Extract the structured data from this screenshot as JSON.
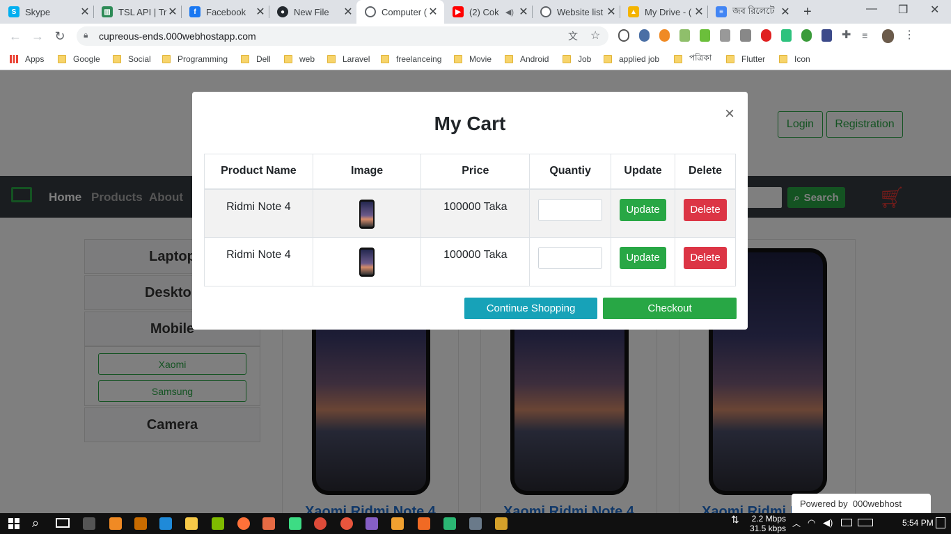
{
  "tabs": [
    {
      "title": "Skype",
      "icon": "skype-icon",
      "color": "#00aff0"
    },
    {
      "title": "TSL API | Tr",
      "icon": "trello-icon",
      "color": "#2e8b57"
    },
    {
      "title": "Facebook",
      "icon": "facebook-icon",
      "color": "#1877f2"
    },
    {
      "title": "New File",
      "icon": "github-icon",
      "color": "#24292e"
    },
    {
      "title": "Computer (",
      "icon": "globe-icon",
      "color": "#5f6368"
    },
    {
      "title": "(2) Cok",
      "icon": "youtube-icon",
      "color": "#ff0000"
    },
    {
      "title": "Website list",
      "icon": "globe-icon",
      "color": "#5f6368"
    },
    {
      "title": "My Drive - (",
      "icon": "drive-icon",
      "color": "#f4b400"
    },
    {
      "title": "জব রিলেটে",
      "icon": "docs-icon",
      "color": "#4285f4"
    }
  ],
  "address": "cupreous-ends.000webhostapp.com",
  "bookmarks": [
    "Apps",
    "Google",
    "Social",
    "Programming",
    "Dell",
    "web",
    "Laravel",
    "freelanceing",
    "Movie",
    "Android",
    "Job",
    "applied job",
    "পত্রিকা",
    "Flutter",
    "Icon"
  ],
  "page": {
    "login": "Login",
    "registration": "Registration",
    "nav": [
      "Home",
      "Products",
      "About"
    ],
    "search_button": "Search",
    "categories": [
      "Laptop",
      "Desktop",
      "Mobile",
      "Camera"
    ],
    "subcategories": [
      "Xaomi",
      "Samsung"
    ],
    "product_title": "Xaomi Ridmi Note 4",
    "badge": "Powered by  000webhost"
  },
  "modal": {
    "title": "My Cart",
    "close": "×",
    "headers": [
      "Product Name",
      "Image",
      "Price",
      "Quantiy",
      "Update",
      "Delete"
    ],
    "rows": [
      {
        "name": "Ridmi Note 4",
        "price": "100000 Taka",
        "update": "Update",
        "delete": "Delete"
      },
      {
        "name": "Ridmi Note 4",
        "price": "100000 Taka",
        "update": "Update",
        "delete": "Delete"
      }
    ],
    "continue": "Continue Shopping",
    "checkout": "Checkout"
  },
  "taskbar": {
    "down_speed": "2.2 Mbps",
    "up_speed": "31.5 kbps",
    "time": "5:54 PM"
  },
  "colors": {
    "green": "#28a745",
    "red": "#dc3545",
    "teal": "#17a2b8",
    "dark": "#343a40"
  }
}
